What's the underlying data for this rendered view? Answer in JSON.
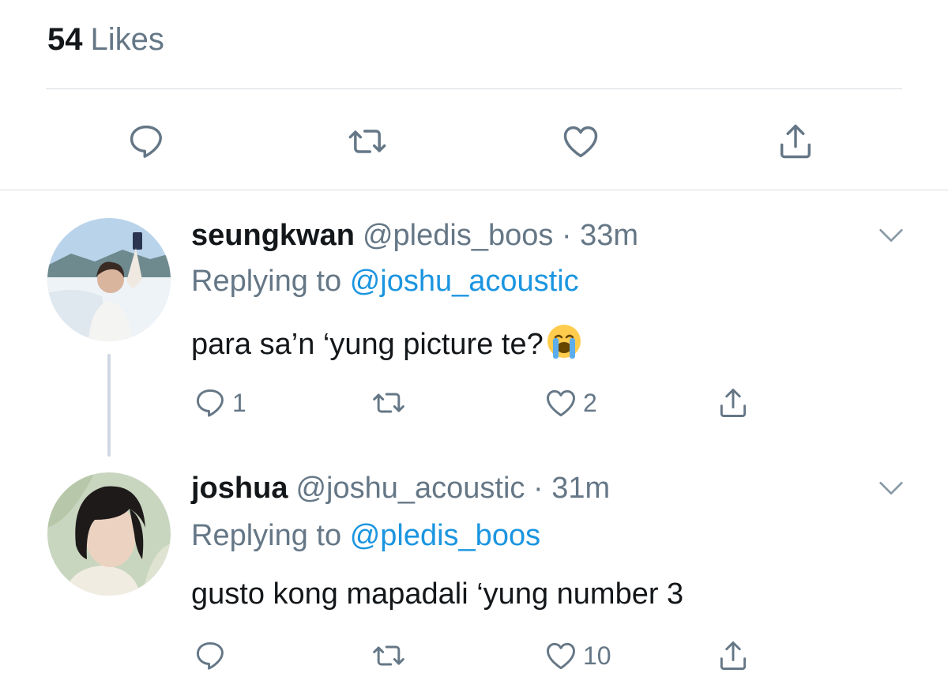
{
  "likes": {
    "count": "54",
    "label": "Likes"
  },
  "colors": {
    "text": "#14171a",
    "secondary": "#657786",
    "link": "#1b95e0",
    "divider": "#d6dbe0"
  },
  "main_actions": [
    {
      "name": "reply-icon"
    },
    {
      "name": "retweet-icon"
    },
    {
      "name": "like-icon"
    },
    {
      "name": "share-icon"
    }
  ],
  "tweets": [
    {
      "name": "seungkwan",
      "handle": "@pledis_boos",
      "time": "· 33m",
      "replying_prefix": "Replying to",
      "replying_to": "@joshu_acoustic",
      "text": "para sa’n ‘yung picture te?",
      "emoji": "loudly-crying-face",
      "reply_count": "1",
      "retweet_count": "",
      "like_count": "2"
    },
    {
      "name": "joshua",
      "handle": "@joshu_acoustic",
      "time": "· 31m",
      "replying_prefix": "Replying to",
      "replying_to": "@pledis_boos",
      "text": "gusto kong mapadali ‘yung number 3",
      "reply_count": "",
      "retweet_count": "",
      "like_count": "10"
    }
  ]
}
